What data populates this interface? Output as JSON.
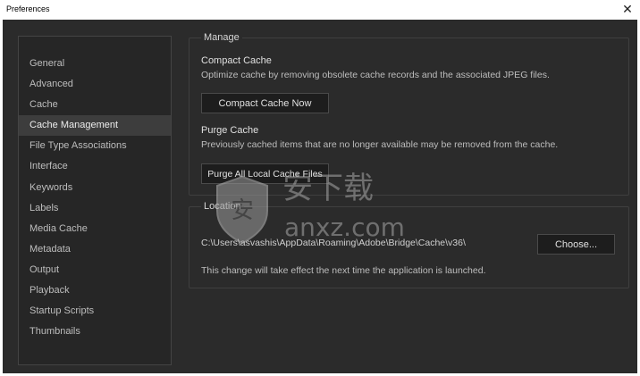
{
  "window": {
    "title": "Preferences",
    "close_glyph": "✕"
  },
  "sidebar": {
    "items": [
      {
        "label": "General"
      },
      {
        "label": "Advanced"
      },
      {
        "label": "Cache"
      },
      {
        "label": "Cache Management",
        "selected": true
      },
      {
        "label": "File Type Associations"
      },
      {
        "label": "Interface"
      },
      {
        "label": "Keywords"
      },
      {
        "label": "Labels"
      },
      {
        "label": "Media Cache"
      },
      {
        "label": "Metadata"
      },
      {
        "label": "Output"
      },
      {
        "label": "Playback"
      },
      {
        "label": "Startup Scripts"
      },
      {
        "label": "Thumbnails"
      }
    ]
  },
  "manage": {
    "group_title": "Manage",
    "compact": {
      "title": "Compact Cache",
      "description": "Optimize cache by removing obsolete cache records and the associated JPEG files.",
      "button": "Compact Cache Now"
    },
    "purge": {
      "title": "Purge Cache",
      "description": "Previously cached items that are no longer available may be removed from the cache.",
      "button": "Purge All Local Cache Files"
    }
  },
  "location": {
    "group_title": "Location",
    "path": "C:\\Users\\asvashis\\AppData\\Roaming\\Adobe\\Bridge\\Cache\\v36\\",
    "choose_button": "Choose...",
    "note": "This change will take effect the next time the application is launched."
  },
  "watermark": {
    "text_cn": "安下载",
    "text_en": "anxz.com"
  },
  "colors": {
    "background": "#2b2b2b",
    "sidebar": "#262626",
    "selected": "#3d3d3d",
    "button": "#1d1d1d"
  }
}
